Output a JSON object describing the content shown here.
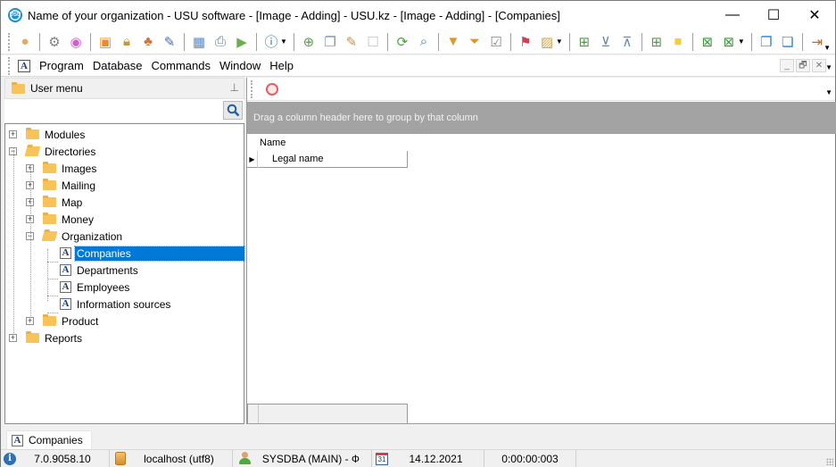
{
  "window": {
    "title": "Name of your organization - USU software - [Image - Adding] - USU.kz - [Image - Adding] - [Companies]",
    "logo_text": "USU",
    "minimize": "—",
    "maximize": "☐",
    "close": "✕"
  },
  "toolbar": {
    "groups": [
      [
        "map-pin-icon"
      ],
      [
        "gear-icon",
        "color-wheel-icon"
      ],
      [
        "rss-icon",
        "lock-icon",
        "users-icon",
        "plugin-icon"
      ],
      [
        "table-icon",
        "printer-icon",
        "play-icon"
      ],
      [
        "info-icon"
      ],
      [
        "add-record-icon",
        "copy-record-icon",
        "edit-record-icon",
        "delete-record-icon"
      ],
      [
        "refresh-icon",
        "search-icon"
      ],
      [
        "filter-icon",
        "filter-apply-icon",
        "filter-check-icon"
      ],
      [
        "flag-icon",
        "image-icon"
      ],
      [
        "expand-columns-icon",
        "expand-all-icon",
        "collapse-all-icon"
      ],
      [
        "add-column-icon",
        "sticky-note-icon"
      ],
      [
        "excel-export-icon",
        "excel-import-icon"
      ],
      [
        "close-window-icon",
        "close-all-windows-icon"
      ],
      [
        "exit-icon"
      ]
    ]
  },
  "menubar": {
    "items": [
      "Program",
      "Database",
      "Commands",
      "Window",
      "Help"
    ],
    "mdi_minimize": "_",
    "mdi_restore": "🗗",
    "mdi_close": "✕"
  },
  "left_panel": {
    "title": "User menu",
    "tree": [
      {
        "label": "Modules",
        "level": 0,
        "type": "folder",
        "expander": "+"
      },
      {
        "label": "Directories",
        "level": 0,
        "type": "folder-open",
        "expander": "−"
      },
      {
        "label": "Images",
        "level": 1,
        "type": "folder",
        "expander": "+"
      },
      {
        "label": "Mailing",
        "level": 1,
        "type": "folder",
        "expander": "+"
      },
      {
        "label": "Map",
        "level": 1,
        "type": "folder",
        "expander": "+"
      },
      {
        "label": "Money",
        "level": 1,
        "type": "folder",
        "expander": "+"
      },
      {
        "label": "Organization",
        "level": 1,
        "type": "folder-open",
        "expander": "−"
      },
      {
        "label": "Companies",
        "level": 2,
        "type": "doc",
        "selected": true
      },
      {
        "label": "Departments",
        "level": 2,
        "type": "doc"
      },
      {
        "label": "Employees",
        "level": 2,
        "type": "doc"
      },
      {
        "label": "Information sources",
        "level": 2,
        "type": "doc"
      },
      {
        "label": "Product",
        "level": 1,
        "type": "folder",
        "expander": "+"
      },
      {
        "label": "Reports",
        "level": 0,
        "type": "folder",
        "expander": "+"
      }
    ]
  },
  "grid": {
    "group_panel_text": "Drag a column header here to group by that column",
    "column_header": "Name",
    "rows": [
      {
        "cell": "Legal name",
        "indicator": "▶"
      }
    ]
  },
  "tabs": [
    {
      "label": "Companies"
    }
  ],
  "statusbar": {
    "version": "7.0.9058.10",
    "connection": "localhost (utf8)",
    "user": "SYSDBA (MAIN) - Ф",
    "calendar_day": "31",
    "date": "14.12.2021",
    "elapsed": "0:00:00:003"
  }
}
